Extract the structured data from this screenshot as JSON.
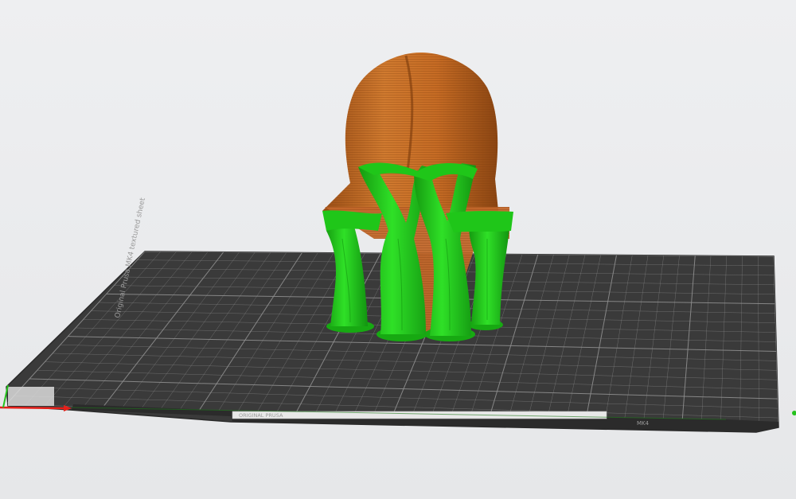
{
  "viewport": {
    "background": "#ecedef",
    "bed": {
      "surface_color": "#3c3c3c",
      "grid_color": "#8f8f8f",
      "edge_label": "Original Prusa MK4 textured sheet",
      "front_strip_label": "ORIGINAL PRUSA",
      "front_strip_label_right": "MK4"
    },
    "model": {
      "part_color": "#c86d28",
      "support_color": "#24d21c"
    },
    "axes": {
      "x_color": "#e5211b",
      "y_color": "#25c21d"
    }
  }
}
